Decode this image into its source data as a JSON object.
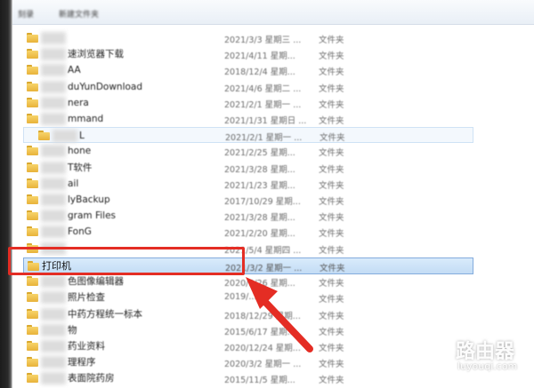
{
  "toolbar": {
    "items": [
      "刻录",
      "新建文件夹"
    ]
  },
  "rows": [
    {
      "name": "",
      "date": "2021/3/3 星期三 ...",
      "type": "文件夹"
    },
    {
      "name": "速浏览器下载",
      "date": "2021/4/11 星期...",
      "type": "文件夹"
    },
    {
      "name": "AA",
      "date": "2018/12/4 星期...",
      "type": "文件夹"
    },
    {
      "name": "duYunDownload",
      "date": "2021/4/6 星期二 ...",
      "type": "文件夹"
    },
    {
      "name": "nera",
      "date": "2021/2/1 星期一 ...",
      "type": "文件夹"
    },
    {
      "name": "mmand",
      "date": "2021/1/31 星期日 ...",
      "type": "文件夹"
    },
    {
      "name": "L",
      "date": "2021/2/1 星期一 ...",
      "type": "文件夹"
    },
    {
      "name": "hone",
      "date": "2021/2/25 星期...",
      "type": "文件夹"
    },
    {
      "name": "T软件",
      "date": "2021/3/28 星期...",
      "type": "文件夹"
    },
    {
      "name": "ail",
      "date": "2021/1/23 星期...",
      "type": "文件夹"
    },
    {
      "name": "lyBackup",
      "date": "2017/10/29 星期...",
      "type": "文件夹"
    },
    {
      "name": "gram Files",
      "date": "2021/3/28 星期...",
      "type": "文件夹"
    },
    {
      "name": "FonG",
      "date": "2021/2/20 星期...",
      "type": "文件夹"
    },
    {
      "name": "",
      "date": "2021/5/4 星期四 ...",
      "type": "文件夹"
    },
    {
      "name": "打印机",
      "date": "2021/3/2 星期一 ...",
      "type": "文件夹"
    },
    {
      "name": "色图像编辑器",
      "date": "2020/3/26 星期...",
      "type": "文件夹"
    },
    {
      "name": "照片检查",
      "date": "2019/...",
      "type": "文件夹"
    },
    {
      "name": "中药方程统一标本",
      "date": "2018/12/29 星期...",
      "type": "文件夹"
    },
    {
      "name": "物",
      "date": "2015/6/17 星期...",
      "type": "文件夹"
    },
    {
      "name": "药业资料",
      "date": "2020/12/24 星期...",
      "type": "文件夹"
    },
    {
      "name": "理程序",
      "date": "2020/3/2 星期一 ...",
      "type": "文件夹"
    },
    {
      "name": "表面院药房",
      "date": "2015/11/5 星期...",
      "type": "文件夹"
    }
  ],
  "watermark": {
    "title": "路由器",
    "subtitle": "luyouqi.com"
  }
}
